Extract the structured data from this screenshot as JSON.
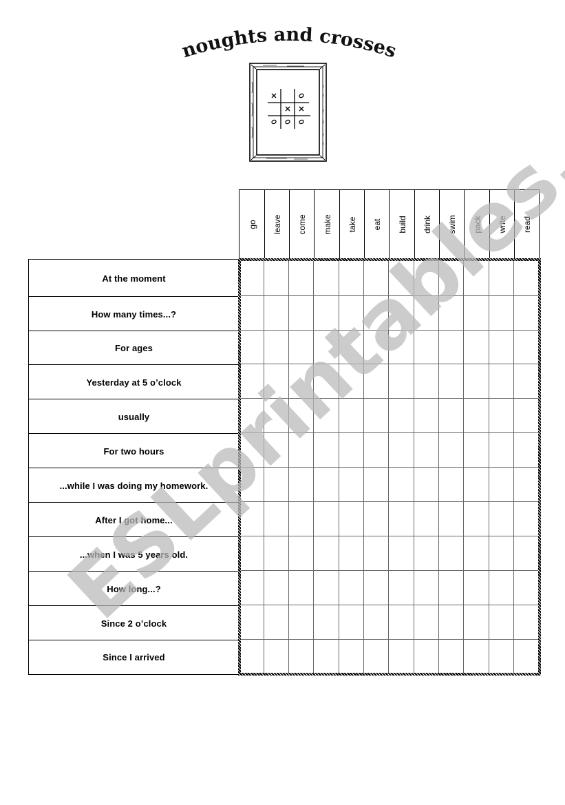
{
  "title": "noughts and crosses",
  "illustration": {
    "description": "framed tic-tac-toe board drawing",
    "board": [
      [
        "x",
        "",
        "o"
      ],
      [
        "",
        "x",
        "x"
      ],
      [
        "o",
        "o",
        "o"
      ]
    ]
  },
  "verbs": [
    "go",
    "leave",
    "come",
    "make",
    "take",
    "eat",
    "build",
    "drink",
    "swim",
    "pack",
    "write",
    "read"
  ],
  "time_expressions": [
    "At the moment",
    "How many times...?",
    "For ages",
    "Yesterday at 5 o’clock",
    "usually",
    "For two hours",
    "...while I was doing my homework.",
    "After I got home...",
    "...when I was 5 years old.",
    "How long...?",
    "Since 2 o’clock",
    "Since I arrived"
  ],
  "watermark": "ESLprintables.com",
  "colors": {
    "grid_line": "#666666",
    "border": "#000000",
    "watermark": "#b9b9b9"
  }
}
